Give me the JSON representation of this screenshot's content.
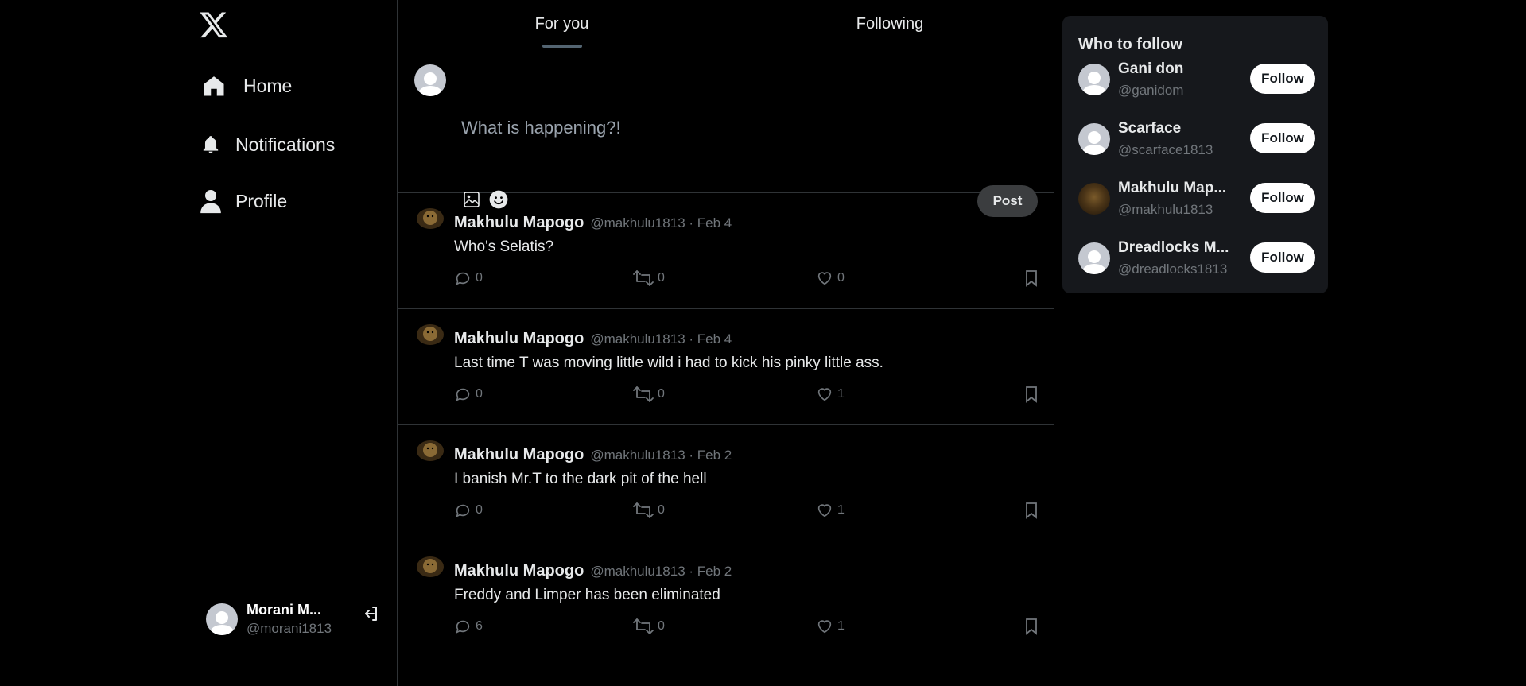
{
  "sidebar": {
    "logo": "x-logo-icon",
    "items": [
      {
        "label": "Home",
        "icon": "home-icon"
      },
      {
        "label": "Notifications",
        "icon": "bell-icon"
      },
      {
        "label": "Profile",
        "icon": "user-icon"
      }
    ],
    "account": {
      "name": "Morani M...",
      "handle": "@morani1813"
    }
  },
  "tabs": [
    {
      "label": "For you",
      "active": true
    },
    {
      "label": "Following",
      "active": false
    }
  ],
  "compose": {
    "placeholder": "What is happening?!",
    "post_label": "Post"
  },
  "tweets": [
    {
      "name": "Makhulu Mapogo",
      "meta": "@makhulu1813 · Feb 4",
      "text": "Who's Selatis?",
      "replies": "0",
      "retweets": "0",
      "likes": "0"
    },
    {
      "name": "Makhulu Mapogo",
      "meta": "@makhulu1813 · Feb 4",
      "text": "Last time T was moving little wild i had to kick his pinky little ass.",
      "replies": "0",
      "retweets": "0",
      "likes": "1"
    },
    {
      "name": "Makhulu Mapogo",
      "meta": "@makhulu1813 · Feb 2",
      "text": "I banish Mr.T to the dark pit of the hell",
      "replies": "0",
      "retweets": "0",
      "likes": "1"
    },
    {
      "name": "Makhulu Mapogo",
      "meta": "@makhulu1813 · Feb 2",
      "text": "Freddy and Limper has been eliminated",
      "replies": "6",
      "retweets": "0",
      "likes": "1"
    }
  ],
  "who_to_follow": {
    "title": "Who to follow",
    "follow_label": "Follow",
    "users": [
      {
        "name": "Gani don",
        "handle": "@ganidom"
      },
      {
        "name": "Scarface",
        "handle": "@scarface1813"
      },
      {
        "name": "Makhulu Map...",
        "handle": "@makhulu1813"
      },
      {
        "name": "Dreadlocks M...",
        "handle": "@dreadlocks1813"
      }
    ]
  },
  "colors": {
    "background": "#000000",
    "border": "#2f3336",
    "muted_text": "#71767b",
    "card_bg": "#16181c"
  }
}
